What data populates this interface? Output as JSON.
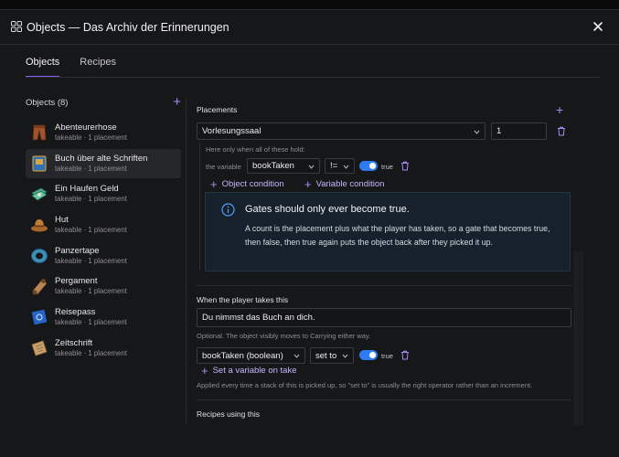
{
  "window": {
    "title": "Objects — Das Archiv der Erinnerungen"
  },
  "tabs": [
    {
      "label": "Objects",
      "active": true
    },
    {
      "label": "Recipes",
      "active": false
    }
  ],
  "objects_panel": {
    "heading": "Objects (8)",
    "items": [
      {
        "name": "Abenteurerhose",
        "sub": "takeable · 1 placement",
        "icon": "trousers-icon"
      },
      {
        "name": "Buch über alte Schriften",
        "sub": "takeable · 1 placement",
        "icon": "book-icon",
        "selected": true
      },
      {
        "name": "Ein Haufen Geld",
        "sub": "takeable · 1 placement",
        "icon": "money-icon"
      },
      {
        "name": "Hut",
        "sub": "takeable · 1 placement",
        "icon": "hat-icon"
      },
      {
        "name": "Panzertape",
        "sub": "takeable · 1 placement",
        "icon": "tape-icon"
      },
      {
        "name": "Pergament",
        "sub": "takeable · 1 placement",
        "icon": "scroll-icon"
      },
      {
        "name": "Reisepass",
        "sub": "takeable · 1 placement",
        "icon": "passport-icon"
      },
      {
        "name": "Zeitschrift",
        "sub": "takeable · 1 placement",
        "icon": "magazine-icon"
      }
    ]
  },
  "placements": {
    "label": "Placements",
    "location": "Vorlesungssaal",
    "count": "1",
    "condition_hint": "Here only when all of these hold:",
    "condition": {
      "prefix": "the variable",
      "variable": "bookTaken",
      "operator": "!=",
      "value": "true"
    },
    "add_object_condition": "Object condition",
    "add_variable_condition": "Variable condition",
    "info": {
      "title": "Gates should only ever become true.",
      "body": "A count is the placement plus what the player has taken, so a gate that becomes true, then false, then true again puts the object back after they picked it up."
    }
  },
  "on_take": {
    "label": "When the player takes this",
    "message": "Du nimmst das Buch an dich.",
    "hint": "Optional. The object visibly moves to Carrying either way.",
    "set_variable": {
      "variable": "bookTaken (boolean)",
      "operator": "set to",
      "value": "true"
    },
    "add_label": "Set a variable on take",
    "note": "Applied every time a stack of this is picked up, so \"set to\" is usually the right operator rather than an increment."
  },
  "recipes_using": {
    "label": "Recipes using this"
  },
  "colors": {
    "accent": "#8b5cf6",
    "toggle": "#2e7bf2",
    "info_bg": "#17212c"
  }
}
